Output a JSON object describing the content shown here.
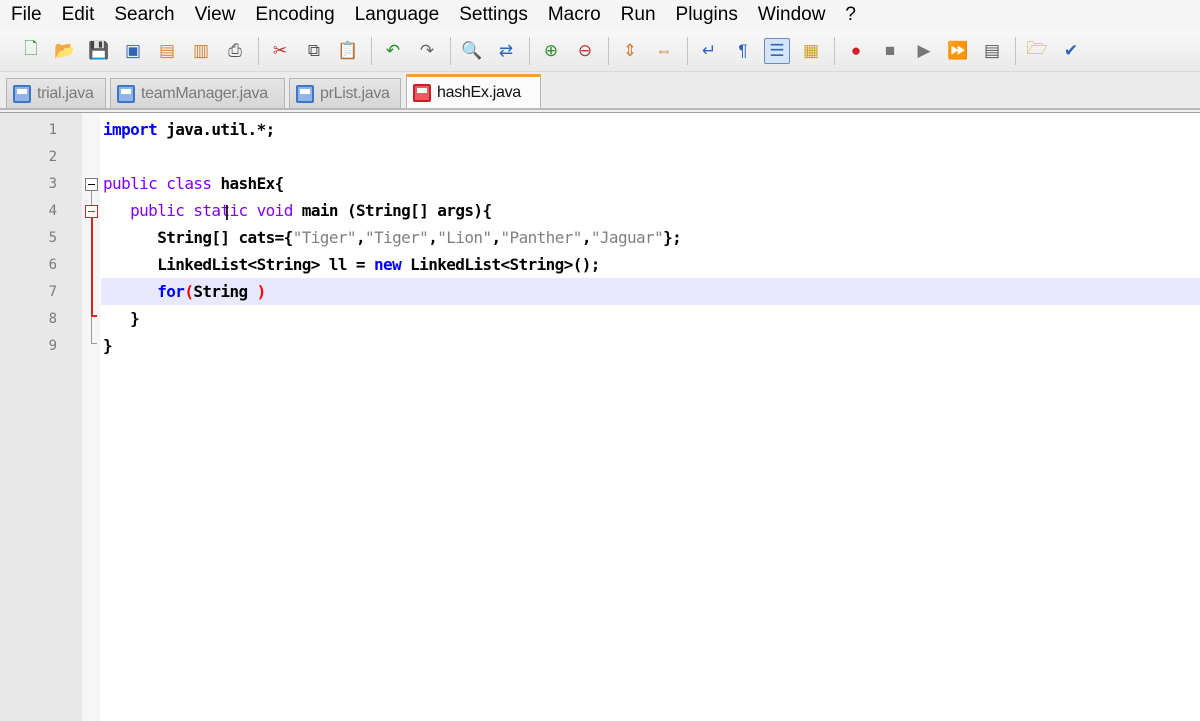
{
  "menu": [
    "File",
    "Edit",
    "Search",
    "View",
    "Encoding",
    "Language",
    "Settings",
    "Macro",
    "Run",
    "Plugins",
    "Window",
    "?"
  ],
  "toolbar_icons": [
    "new-file-icon",
    "open-file-icon",
    "save-icon",
    "save-all-icon",
    "close-icon",
    "close-all-icon",
    "print-icon",
    "cut-icon",
    "copy-icon",
    "paste-icon",
    "undo-icon",
    "redo-icon",
    "find-icon",
    "replace-icon",
    "zoom-in-icon",
    "zoom-out-icon",
    "sync-vertical-icon",
    "sync-horizontal-icon",
    "word-wrap-icon",
    "show-all-chars-icon",
    "indent-guide-icon",
    "user-language-icon",
    "record-macro-icon",
    "stop-record-icon",
    "play-macro-icon",
    "run-macro-multiple-icon",
    "save-macro-icon",
    "view-in-browser-icon",
    "spell-check-icon"
  ],
  "tabs": [
    {
      "label": "trial.java"
    },
    {
      "label": "teamManager.java"
    },
    {
      "label": "prList.java"
    },
    {
      "label": "hashEx.java"
    }
  ],
  "colors": {
    "keyword": "#0000ff",
    "keyword2": "#8000ff",
    "string": "#808080",
    "brace_match": "#ff0000",
    "active_tab_accent": "#f2a131",
    "current_line": "#e8e8ff"
  },
  "code": {
    "line_numbers": [
      "1",
      "2",
      "3",
      "4",
      "5",
      "6",
      "7",
      "8",
      "9"
    ],
    "l1": {
      "kw": "import",
      "rest": " java.util.*;"
    },
    "l3": {
      "kw1": "public",
      "kw2": "class",
      "rest": " hashEx{"
    },
    "l4": {
      "indent": "   ",
      "kw1": "public",
      "kw2": "static",
      "kw3": "void",
      "rest": " main (String[] args){"
    },
    "l5": {
      "indent": "      ",
      "pre": "String[] cats={",
      "s1": "\"Tiger\"",
      "c1": ",",
      "s2": "\"Tiger\"",
      "c2": ",",
      "s3": "\"Lion\"",
      "c3": ",",
      "s4": "\"Panther\"",
      "c4": ",",
      "s5": "\"Jaguar\"",
      "post": "};"
    },
    "l6": {
      "indent": "      ",
      "pre": "LinkedList<String> ll = ",
      "kw": "new",
      "post": " LinkedList<String>();"
    },
    "l7": {
      "indent": "      ",
      "kw": "for",
      "open": "(",
      "mid": "String ",
      "close": ")"
    },
    "l8": {
      "indent": "   ",
      "brace": "}"
    },
    "l9": {
      "brace": "}"
    }
  }
}
